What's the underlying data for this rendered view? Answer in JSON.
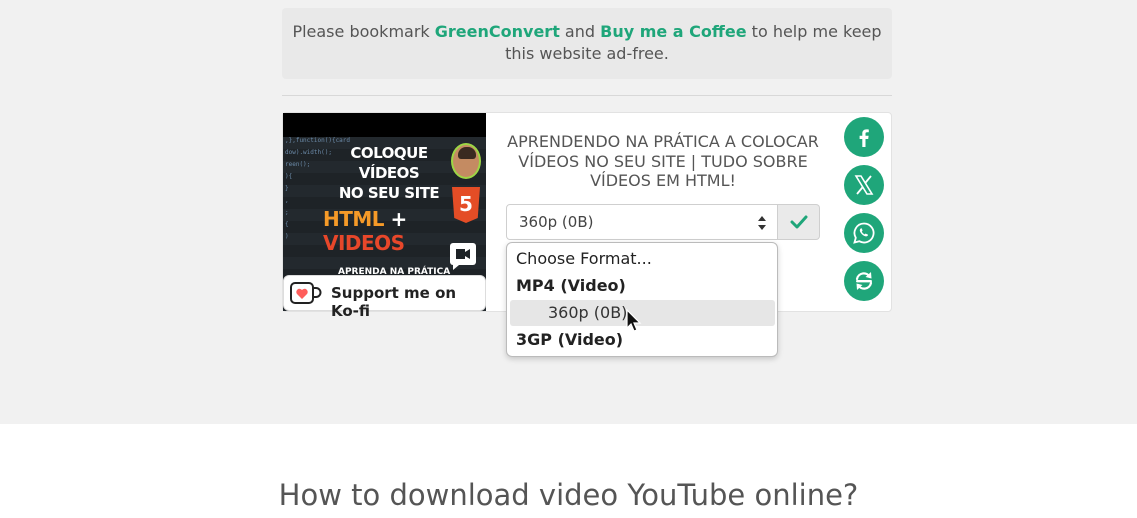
{
  "notice": {
    "text_before": "Please bookmark ",
    "brand_green": "Green",
    "brand_convert": "Convert",
    "text_and": " and ",
    "coffee_link": "Buy me a Coffee",
    "text_after": " to help me keep this website ad-free."
  },
  "thumbnail": {
    "line1": "COLOQUE VÍDEOS",
    "line2": "NO SEU SITE",
    "html": "HTML",
    "plus": "+",
    "videos": "VIDEOS",
    "bottom": "APRENDA NA PRÁTICA",
    "shield_number": "5"
  },
  "kofi": {
    "label": "Support me on Ko-fi"
  },
  "video": {
    "title": "APRENDENDO NA PRÁTICA A COLOCAR VÍDEOS NO SEU SITE | TUDO SOBRE VÍDEOS EM HTML!"
  },
  "format_select": {
    "selected": "360p (0B)",
    "options": {
      "placeholder": "Choose Format...",
      "group_mp4": "MP4 (Video)",
      "mp4_360": "360p (0B)",
      "group_3gp": "3GP (Video)"
    }
  },
  "social": [
    "facebook-icon",
    "x-icon",
    "whatsapp-icon",
    "share-icon"
  ],
  "colors": {
    "accent": "#1fa67a",
    "background": "#f1f1f1"
  },
  "howto": {
    "heading": "How to download video YouTube online?"
  }
}
